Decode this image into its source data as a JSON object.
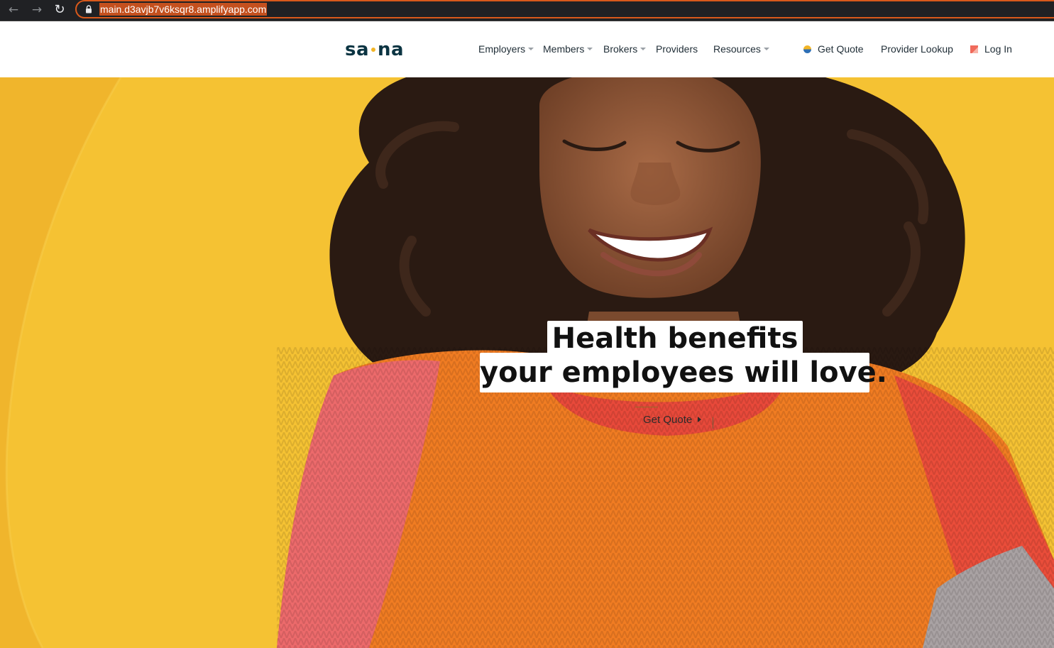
{
  "browser": {
    "url": "main.d3avjb7v6ksqr8.amplifyapp.com"
  },
  "header": {
    "logo_left": "sa",
    "logo_right": "na",
    "nav": [
      {
        "label": "Employers"
      },
      {
        "label": "Members"
      },
      {
        "label": "Brokers"
      },
      {
        "label": "Providers"
      },
      {
        "label": "Resources"
      }
    ],
    "utility": {
      "get_quote": "Get Quote",
      "provider_lookup": "Provider Lookup",
      "log_in": "Log In"
    }
  },
  "hero": {
    "headline_line1": "Health benefits",
    "headline_line2": "your employees will love.",
    "cta_label": "Get Quote"
  },
  "colors": {
    "brand_dark": "#0b3442",
    "brand_yellow": "#f2b527",
    "hero_background": "#f5c233"
  }
}
